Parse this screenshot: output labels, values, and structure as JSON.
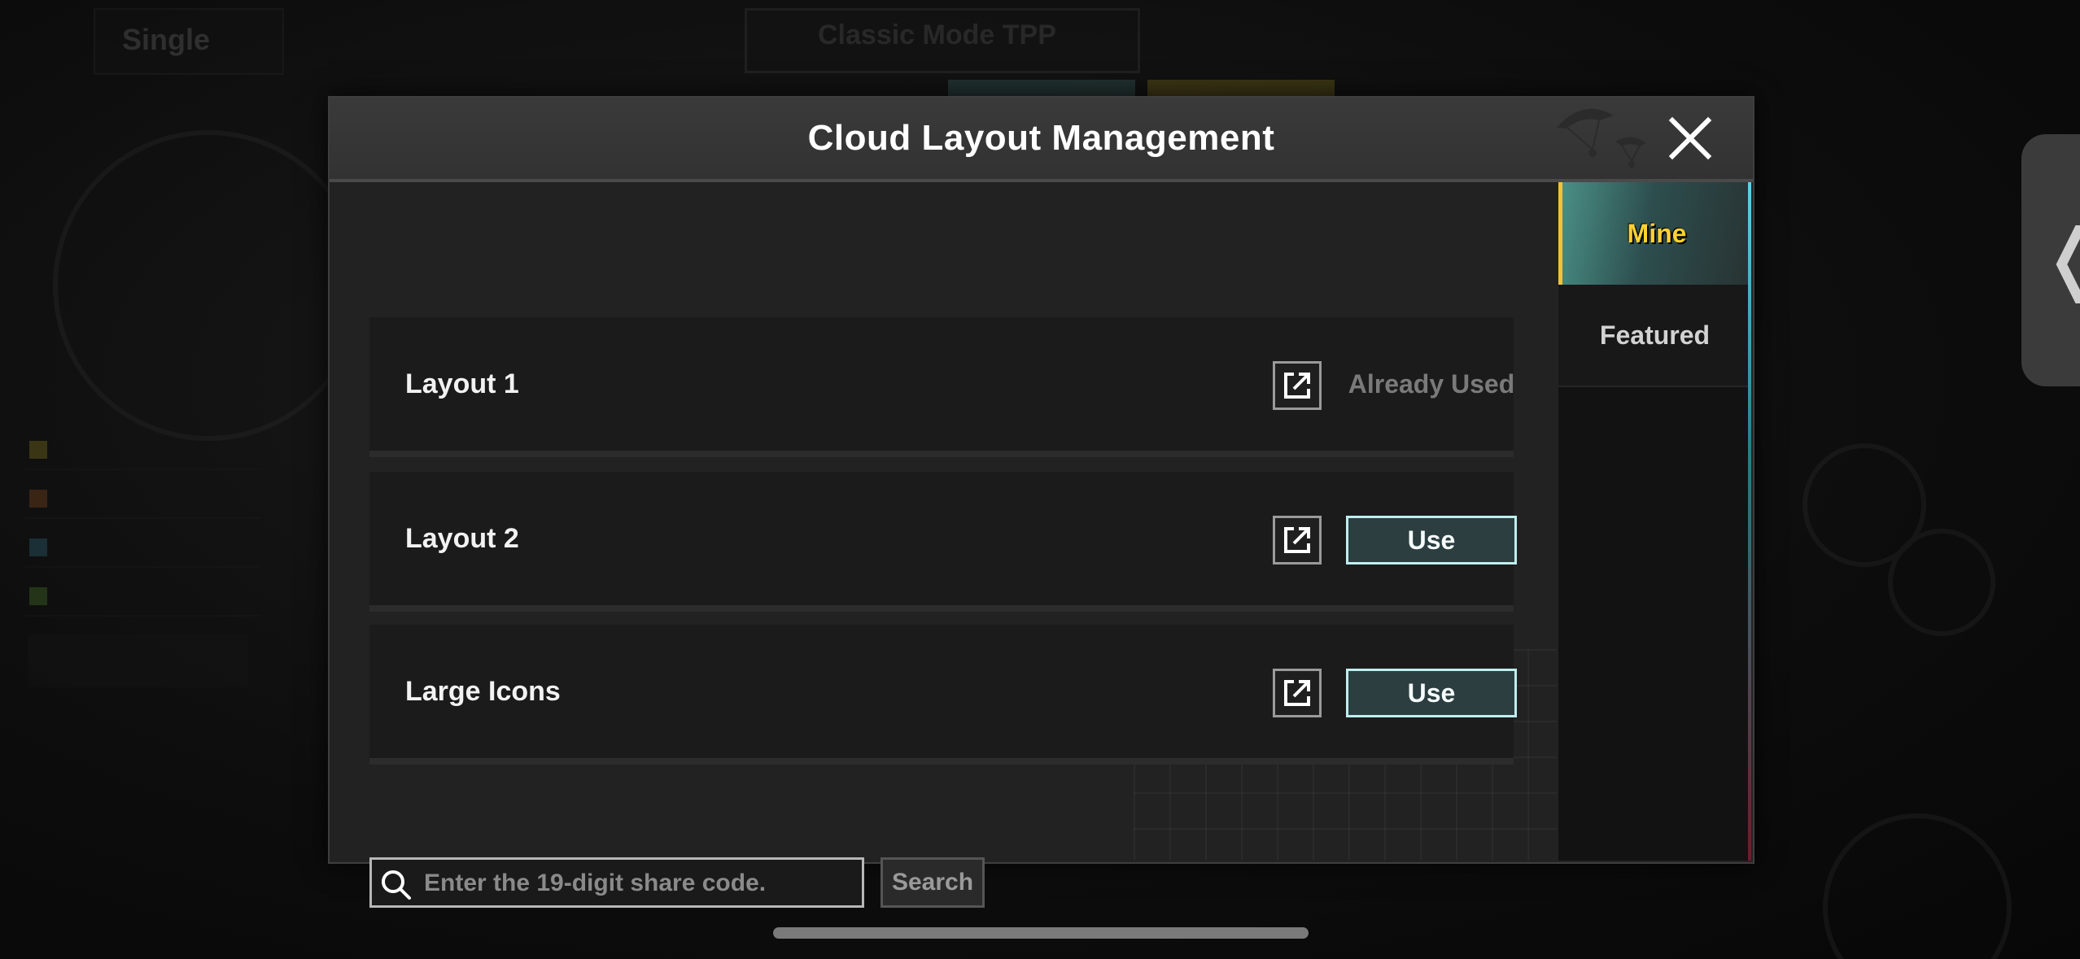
{
  "background": {
    "mode_label": "Single",
    "dropdown_label": "Classic Mode TPP",
    "side_handle_icon": "chevron-left-icon"
  },
  "dialog": {
    "title": "Cloud Layout Management",
    "close_icon": "close-icon",
    "layouts": [
      {
        "label": "Layout 1",
        "status": "Already Used",
        "in_use": true
      },
      {
        "label": "Layout 2",
        "action": "Use",
        "in_use": false
      },
      {
        "label": "Large Icons",
        "action": "Use",
        "in_use": false
      }
    ],
    "search": {
      "placeholder": "Enter the 19-digit share code.",
      "value": "",
      "button_label": "Search"
    },
    "tabs": [
      {
        "label": "Mine",
        "selected": true
      },
      {
        "label": "Featured",
        "selected": false
      }
    ]
  },
  "colors": {
    "selected_tab_text": "#ffd233",
    "use_button_border": "#bfeeee",
    "use_button_fill": "#2c3e40"
  }
}
